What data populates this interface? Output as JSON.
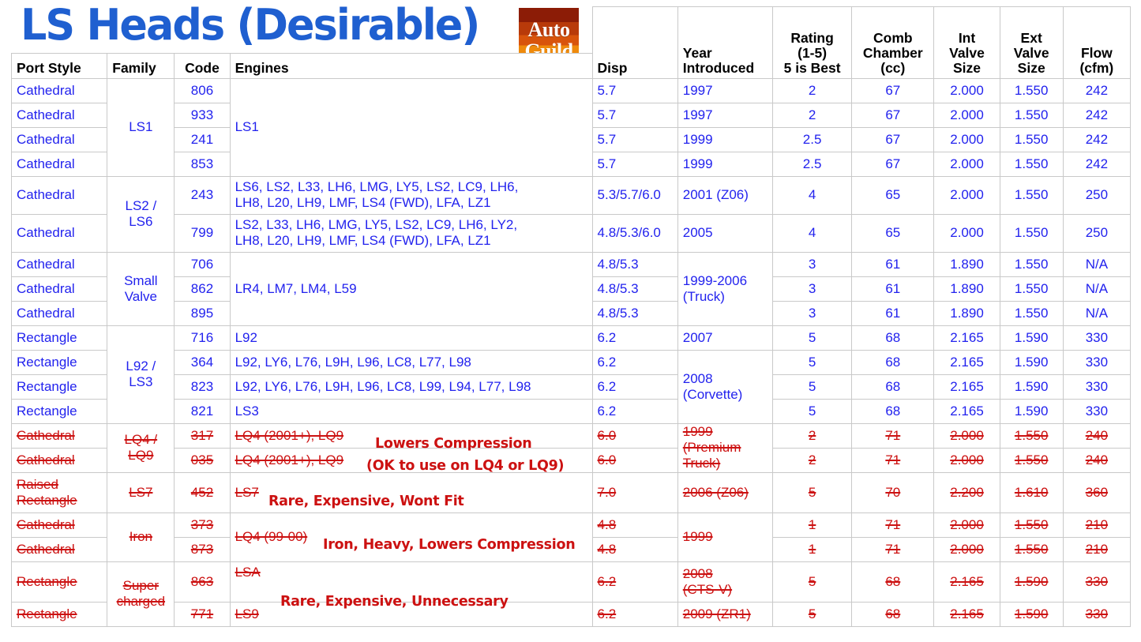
{
  "title": "LS Heads (Desirable)",
  "logo": {
    "line1": "Auto",
    "line2": "Guild"
  },
  "colors": {
    "blue": "#2222ee",
    "title_blue": "#1f5fd0",
    "red": "#cc1111",
    "border": "#c9c9c9"
  },
  "headers": {
    "port_style": "Port Style",
    "family": "Family",
    "code": "Code",
    "engines": "Engines",
    "disp": "Disp",
    "year_introduced": "Year\nIntroduced",
    "year_line1": "Year",
    "year_line2": "Introduced",
    "rating_line1": "Rating",
    "rating_line2": "(1-5)",
    "rating_line3": "5 is Best",
    "comb_line1": "Comb",
    "comb_line2": "Chamber",
    "comb_line3": "(cc)",
    "int_line1": "Int",
    "int_line2": "Valve",
    "int_line3": "Size",
    "ext_line1": "Ext",
    "ext_line2": "Valve",
    "ext_line3": "Size",
    "flow_line1": "Flow",
    "flow_line2": "(cfm)"
  },
  "groups": {
    "ls1": "LS1",
    "ls2_ls6_l1": "LS2 /",
    "ls2_ls6_l2": "LS6",
    "smallvalve_l1": "Small",
    "smallvalve_l2": "Valve",
    "l92_ls3_l1": "L92 /",
    "l92_ls3_l2": "LS3",
    "lq4_lq9_l1": "LQ4 /",
    "lq4_lq9_l2": "LQ9",
    "ls7": "LS7",
    "iron": "Iron",
    "super_l1": "Super",
    "super_l2": "charged"
  },
  "engine_cells": {
    "ls1": "LS1",
    "e243_l1": "LS6, LS2, L33, LH6, LMG, LY5, LS2, LC9, LH6,",
    "e243_l2": "LH8, L20, LH9, LMF, LS4 (FWD), LFA, LZ1",
    "e799_l1": "LS2, L33, LH6, LMG, LY5, LS2, LC9, LH6, LY2,",
    "e799_l2": "LH8, L20, LH9, LMF, LS4 (FWD), LFA, LZ1",
    "smallvalve": "LR4, LM7, LM4, L59",
    "e716": "L92",
    "e364": "L92, LY6, L76, L9H, L96, LC8, L77, L98",
    "e823": "L92, LY6, L76, L9H, L96, LC8, L99, L94, L77, L98",
    "e821": "LS3",
    "lq4_lq9": "LQ4 (2001+), LQ9",
    "ls7": "LS7",
    "lq4_9900": "LQ4 (99-00)",
    "lsa": "LSA",
    "ls9": "LS9"
  },
  "years": {
    "y1997": "1997",
    "y1999": "1999",
    "y2001_z06": "2001 (Z06)",
    "y2005": "2005",
    "truck_l1": "1999-2006",
    "truck_l2": "(Truck)",
    "y2007": "2007",
    "corvette_l1": "2008",
    "corvette_l2": "(Corvette)",
    "prem_l1": "1999",
    "prem_l2": "(Premium",
    "prem_l3": "Truck)",
    "y2006_z06": "2006 (Z06)",
    "y1999_iron": "1999",
    "ctsv_l1": "2008",
    "ctsv_l2": "(CTS-V)",
    "zr1": "2009 (ZR1)"
  },
  "annotations": {
    "lowers_compression": "Lowers Compression",
    "ok_to_use": "(OK to use on LQ4 or LQ9)",
    "rare_wont_fit": "Rare, Expensive, Wont Fit",
    "iron_heavy": "Iron, Heavy, Lowers Compression",
    "rare_unnecessary": "Rare, Expensive, Unnecessary"
  },
  "rows": [
    {
      "port": "Cathedral",
      "code": "806",
      "disp": "5.7",
      "rating": "2",
      "cc": "67",
      "int": "2.000",
      "ext": "1.550",
      "flow": "242"
    },
    {
      "port": "Cathedral",
      "code": "933",
      "disp": "5.7",
      "rating": "2",
      "cc": "67",
      "int": "2.000",
      "ext": "1.550",
      "flow": "242"
    },
    {
      "port": "Cathedral",
      "code": "241",
      "disp": "5.7",
      "rating": "2.5",
      "cc": "67",
      "int": "2.000",
      "ext": "1.550",
      "flow": "242"
    },
    {
      "port": "Cathedral",
      "code": "853",
      "disp": "5.7",
      "rating": "2.5",
      "cc": "67",
      "int": "2.000",
      "ext": "1.550",
      "flow": "242"
    },
    {
      "port": "Cathedral",
      "code": "243",
      "disp": "5.3/5.7/6.0",
      "rating": "4",
      "cc": "65",
      "int": "2.000",
      "ext": "1.550",
      "flow": "250"
    },
    {
      "port": "Cathedral",
      "code": "799",
      "disp": "4.8/5.3/6.0",
      "rating": "4",
      "cc": "65",
      "int": "2.000",
      "ext": "1.550",
      "flow": "250"
    },
    {
      "port": "Cathedral",
      "code": "706",
      "disp": "4.8/5.3",
      "rating": "3",
      "cc": "61",
      "int": "1.890",
      "ext": "1.550",
      "flow": "N/A"
    },
    {
      "port": "Cathedral",
      "code": "862",
      "disp": "4.8/5.3",
      "rating": "3",
      "cc": "61",
      "int": "1.890",
      "ext": "1.550",
      "flow": "N/A"
    },
    {
      "port": "Cathedral",
      "code": "895",
      "disp": "4.8/5.3",
      "rating": "3",
      "cc": "61",
      "int": "1.890",
      "ext": "1.550",
      "flow": "N/A"
    },
    {
      "port": "Rectangle",
      "code": "716",
      "disp": "6.2",
      "rating": "5",
      "cc": "68",
      "int": "2.165",
      "ext": "1.590",
      "flow": "330"
    },
    {
      "port": "Rectangle",
      "code": "364",
      "disp": "6.2",
      "rating": "5",
      "cc": "68",
      "int": "2.165",
      "ext": "1.590",
      "flow": "330"
    },
    {
      "port": "Rectangle",
      "code": "823",
      "disp": "6.2",
      "rating": "5",
      "cc": "68",
      "int": "2.165",
      "ext": "1.590",
      "flow": "330"
    },
    {
      "port": "Rectangle",
      "code": "821",
      "disp": "6.2",
      "rating": "5",
      "cc": "68",
      "int": "2.165",
      "ext": "1.590",
      "flow": "330"
    },
    {
      "port": "Cathedral",
      "code": "317",
      "disp": "6.0",
      "rating": "2",
      "cc": "71",
      "int": "2.000",
      "ext": "1.550",
      "flow": "240"
    },
    {
      "port": "Cathedral",
      "code": "035",
      "disp": "6.0",
      "rating": "2",
      "cc": "71",
      "int": "2.000",
      "ext": "1.550",
      "flow": "240"
    },
    {
      "port_l1": "Raised",
      "port_l2": "Rectangle",
      "code": "452",
      "disp": "7.0",
      "rating": "5",
      "cc": "70",
      "int": "2.200",
      "ext": "1.610",
      "flow": "360"
    },
    {
      "port": "Cathedral",
      "code": "373",
      "disp": "4.8",
      "rating": "1",
      "cc": "71",
      "int": "2.000",
      "ext": "1.550",
      "flow": "210"
    },
    {
      "port": "Cathedral",
      "code": "873",
      "disp": "4.8",
      "rating": "1",
      "cc": "71",
      "int": "2.000",
      "ext": "1.550",
      "flow": "210"
    },
    {
      "port": "Rectangle",
      "code": "863",
      "disp": "6.2",
      "rating": "5",
      "cc": "68",
      "int": "2.165",
      "ext": "1.590",
      "flow": "330"
    },
    {
      "port": "Rectangle",
      "code": "771",
      "disp": "6.2",
      "rating": "5",
      "cc": "68",
      "int": "2.165",
      "ext": "1.590",
      "flow": "330"
    }
  ]
}
